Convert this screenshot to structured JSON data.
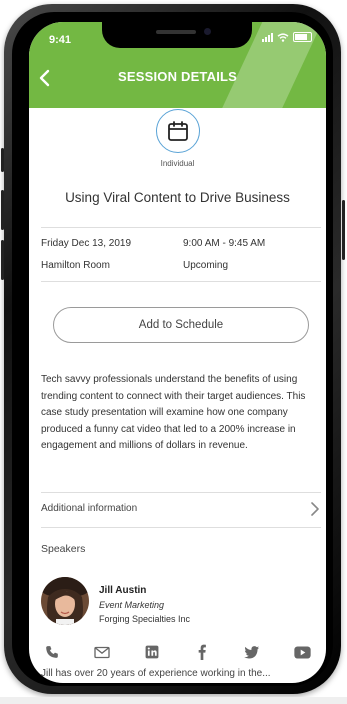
{
  "status_bar": {
    "time": "9:41"
  },
  "header": {
    "title": "SESSION DETAILS"
  },
  "session": {
    "type": "Individual",
    "title": "Using Viral Content to Drive Business",
    "date": "Friday Dec 13, 2019",
    "time_range": "9:00 AM - 9:45 AM",
    "location": "Hamilton Room",
    "status": "Upcoming"
  },
  "actions": {
    "add_to_schedule": "Add to Schedule"
  },
  "description": "Tech savvy professionals understand the benefits of using trending content to connect with their target audiences. This case study presentation will examine how one company produced a funny cat video that led to a 200% increase in engagement and millions of dollars in revenue.",
  "additional_info": {
    "label": "Additional information"
  },
  "speakers": {
    "heading": "Speakers",
    "items": [
      {
        "name": "Jill Austin",
        "role": "Event Marketing",
        "company": "Forging Specialties Inc"
      }
    ]
  },
  "contact_icons": [
    "phone-icon",
    "mail-icon",
    "linkedin-icon",
    "facebook-icon",
    "twitter-icon",
    "youtube-icon"
  ],
  "cut_off_text": "Jill has over 20 years of experience working in the...",
  "colors": {
    "accent": "#73b843",
    "icon_blue": "#5aa3d6"
  }
}
